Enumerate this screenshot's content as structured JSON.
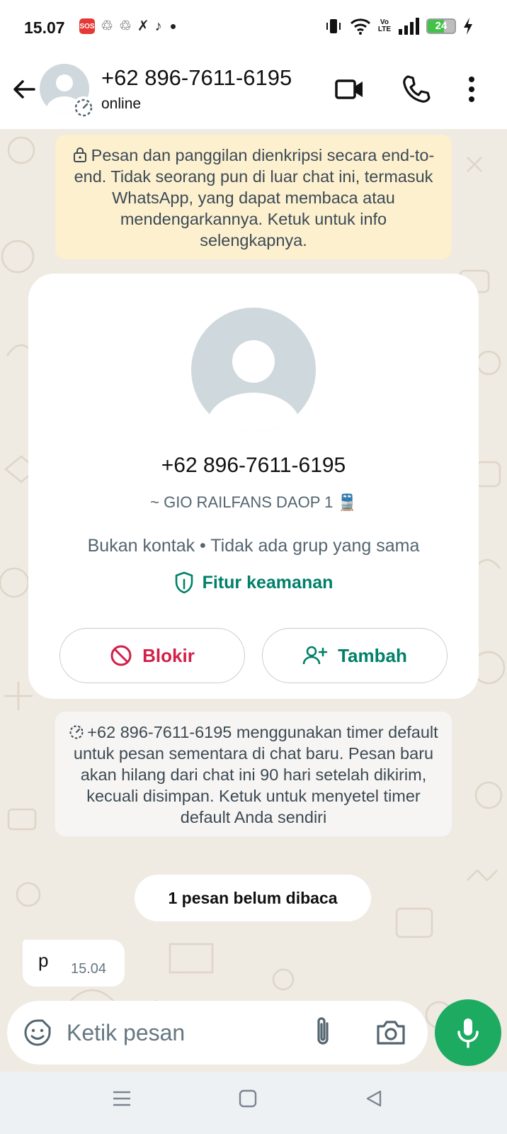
{
  "status_bar": {
    "time": "15.07",
    "sos_label": "SOS",
    "volte_top": "Vo",
    "volte_bottom": "LTE",
    "battery_level": "24"
  },
  "header": {
    "contact_name": "+62 896-7611-6195",
    "presence": "online"
  },
  "encryption_notice": "Pesan dan panggilan dienkripsi secara end-to-end. Tidak seorang pun di luar chat ini, termasuk WhatsApp, yang dapat membaca atau mendengarkannya. Ketuk untuk info selengkapnya.",
  "contact_card": {
    "phone": "+62 896-7611-6195",
    "alias": "~ GIO RAILFANS DAOP 1 🚆",
    "relation": "Bukan kontak • Tidak ada grup yang sama",
    "security_label": "Fitur keamanan",
    "block_label": "Blokir",
    "add_label": "Tambah"
  },
  "disappearing_notice": "+62 896-7611-6195 menggunakan timer default untuk pesan sementara di chat baru. Pesan baru akan hilang dari chat ini 90 hari setelah dikirim, kecuali disimpan. Ketuk untuk menyetel timer default Anda sendiri",
  "unread_divider": "1 pesan belum dibaca",
  "messages": [
    {
      "text": "p",
      "time": "15.04"
    }
  ],
  "composer": {
    "placeholder": "Ketik pesan"
  },
  "colors": {
    "accent_green": "#008069",
    "mic_green": "#1daa61",
    "block_red": "#d1204a",
    "notice_yellow": "#fdf0cf",
    "chat_bg": "#efeae2"
  }
}
